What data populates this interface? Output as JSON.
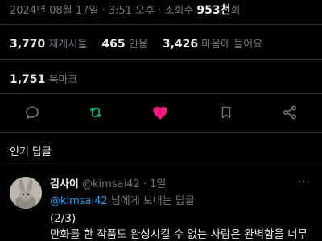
{
  "post_meta": {
    "timestamp": "2024년 08월 17일 · 3:51 오후",
    "views_label": "조회수",
    "views_value": "953천",
    "views_unit": "회"
  },
  "stats": {
    "reposts_value": "3,770",
    "reposts_label": "재게시물",
    "quotes_value": "465",
    "quotes_label": "인용",
    "likes_value": "3,426",
    "likes_label": "마음에 들어요"
  },
  "bookmarks": {
    "value": "1,751",
    "label": "북마크"
  },
  "actions": [
    {
      "icon": "reply-icon"
    },
    {
      "icon": "repost-icon",
      "color": "#00ba7c"
    },
    {
      "icon": "heart-icon",
      "color": "#f91880"
    },
    {
      "icon": "bookmark-icon"
    },
    {
      "icon": "share-icon"
    }
  ],
  "replies_section": {
    "title": "인기 답글"
  },
  "reply": {
    "name": "김사이",
    "handle": "@kimsai42",
    "separator": "·",
    "time": "1일",
    "more": "···",
    "replying_to_mention": "@kimsai42",
    "replying_to_suffix": " 님에게 보내는 답글",
    "lines": [
      "(2/3)",
      "만화를 한 작품도 완성시킬 수 없는 사람은 완벽함을 너무"
    ]
  },
  "colors": {
    "background": "#000000",
    "text": "#e7e9ea",
    "muted": "#71767b",
    "link": "#1d9bf0",
    "repost": "#00ba7c",
    "like": "#f91880",
    "divider": "#2f3336"
  }
}
